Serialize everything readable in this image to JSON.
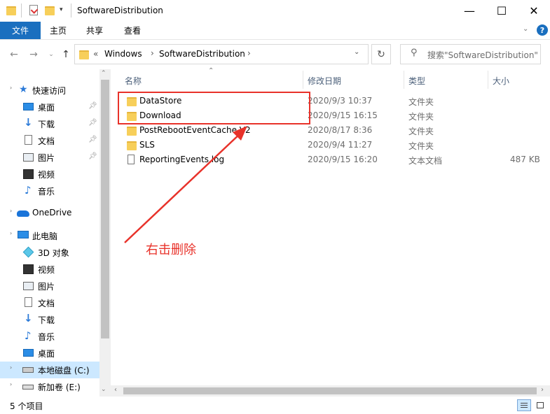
{
  "window": {
    "title": "SoftwareDistribution",
    "minimize_glyph": "—",
    "maximize_glyph": "☐",
    "close_glyph": "✕"
  },
  "ribbon": {
    "tabs": [
      "文件",
      "主页",
      "共享",
      "查看"
    ],
    "help_glyph": "?"
  },
  "address": {
    "prefix": "«",
    "crumbs": [
      "Windows",
      "SoftwareDistribution"
    ],
    "search_placeholder": "搜索\"SoftwareDistribution\""
  },
  "sidebar": {
    "quick_access": {
      "label": "快速访问",
      "items": [
        {
          "label": "桌面",
          "icon": "desktop-icon"
        },
        {
          "label": "下载",
          "icon": "download-icon"
        },
        {
          "label": "文档",
          "icon": "document-icon"
        },
        {
          "label": "图片",
          "icon": "picture-icon"
        },
        {
          "label": "视频",
          "icon": "video-icon"
        },
        {
          "label": "音乐",
          "icon": "music-icon"
        }
      ]
    },
    "onedrive": {
      "label": "OneDrive"
    },
    "this_pc": {
      "label": "此电脑",
      "items": [
        {
          "label": "3D 对象",
          "icon": "3d-objects-icon"
        },
        {
          "label": "视频",
          "icon": "video-icon"
        },
        {
          "label": "图片",
          "icon": "picture-icon"
        },
        {
          "label": "文档",
          "icon": "document-icon"
        },
        {
          "label": "下载",
          "icon": "download-icon"
        },
        {
          "label": "音乐",
          "icon": "music-icon"
        },
        {
          "label": "桌面",
          "icon": "desktop-icon"
        },
        {
          "label": "本地磁盘 (C:)",
          "icon": "local-disk-icon",
          "selected": true
        },
        {
          "label": "新加卷 (E:)",
          "icon": "drive-icon"
        }
      ]
    }
  },
  "columns": {
    "name": "名称",
    "modified": "修改日期",
    "type": "类型",
    "size": "大小"
  },
  "files": [
    {
      "name": "DataStore",
      "modified": "2020/9/3 10:37",
      "type": "文件夹",
      "size": "",
      "icon": "folder-icon"
    },
    {
      "name": "Download",
      "modified": "2020/9/15 16:15",
      "type": "文件夹",
      "size": "",
      "icon": "folder-icon"
    },
    {
      "name": "PostRebootEventCache.V2",
      "modified": "2020/8/17 8:36",
      "type": "文件夹",
      "size": "",
      "icon": "folder-icon"
    },
    {
      "name": "SLS",
      "modified": "2020/9/4 11:27",
      "type": "文件夹",
      "size": "",
      "icon": "folder-icon"
    },
    {
      "name": "ReportingEvents.log",
      "modified": "2020/9/15 16:20",
      "type": "文本文档",
      "size": "487 KB",
      "icon": "text-file-icon"
    }
  ],
  "status": {
    "count": "5 个项目"
  },
  "annotation": {
    "text": "右击删除",
    "color": "#e8322a"
  },
  "colors": {
    "accent": "#1a6fbf",
    "selection": "#cce8ff",
    "folder": "#f7cf5a"
  }
}
